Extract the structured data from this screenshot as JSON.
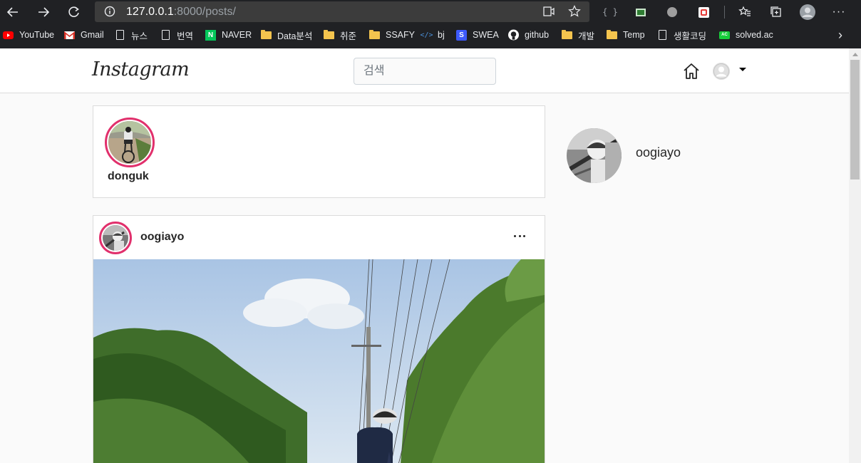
{
  "browser": {
    "url_host": "127.0.0.1",
    "url_path": ":8000/posts/",
    "bookmarks": [
      {
        "label": "YouTube",
        "icon": "youtube-icon"
      },
      {
        "label": "Gmail",
        "icon": "gmail-icon"
      },
      {
        "label": "뉴스",
        "icon": "page-icon"
      },
      {
        "label": "번역",
        "icon": "page-icon"
      },
      {
        "label": "NAVER",
        "icon": "naver-icon"
      },
      {
        "label": "Data분석",
        "icon": "folder-icon"
      },
      {
        "label": "취준",
        "icon": "folder-icon"
      },
      {
        "label": "SSAFY",
        "icon": "folder-icon"
      },
      {
        "label": "bj",
        "icon": "code-icon"
      },
      {
        "label": "SWEA",
        "icon": "swea-icon"
      },
      {
        "label": "github",
        "icon": "github-icon"
      },
      {
        "label": "개발",
        "icon": "folder-icon"
      },
      {
        "label": "Temp",
        "icon": "folder-icon"
      },
      {
        "label": "생활코딩",
        "icon": "page-icon"
      },
      {
        "label": "solved.ac",
        "icon": "solvedac-icon"
      }
    ],
    "more_bookmarks": "›"
  },
  "navbar": {
    "logo": "Instagram",
    "search_placeholder": "검색"
  },
  "stories": [
    {
      "username": "donguk"
    }
  ],
  "post": {
    "username": "oogiayo"
  },
  "sidebar": {
    "username": "oogiayo"
  },
  "colors": {
    "accent_ring": "#e1306c",
    "chrome_bg": "#202124",
    "page_bg": "#fafafa",
    "border": "#dbdbdb"
  }
}
